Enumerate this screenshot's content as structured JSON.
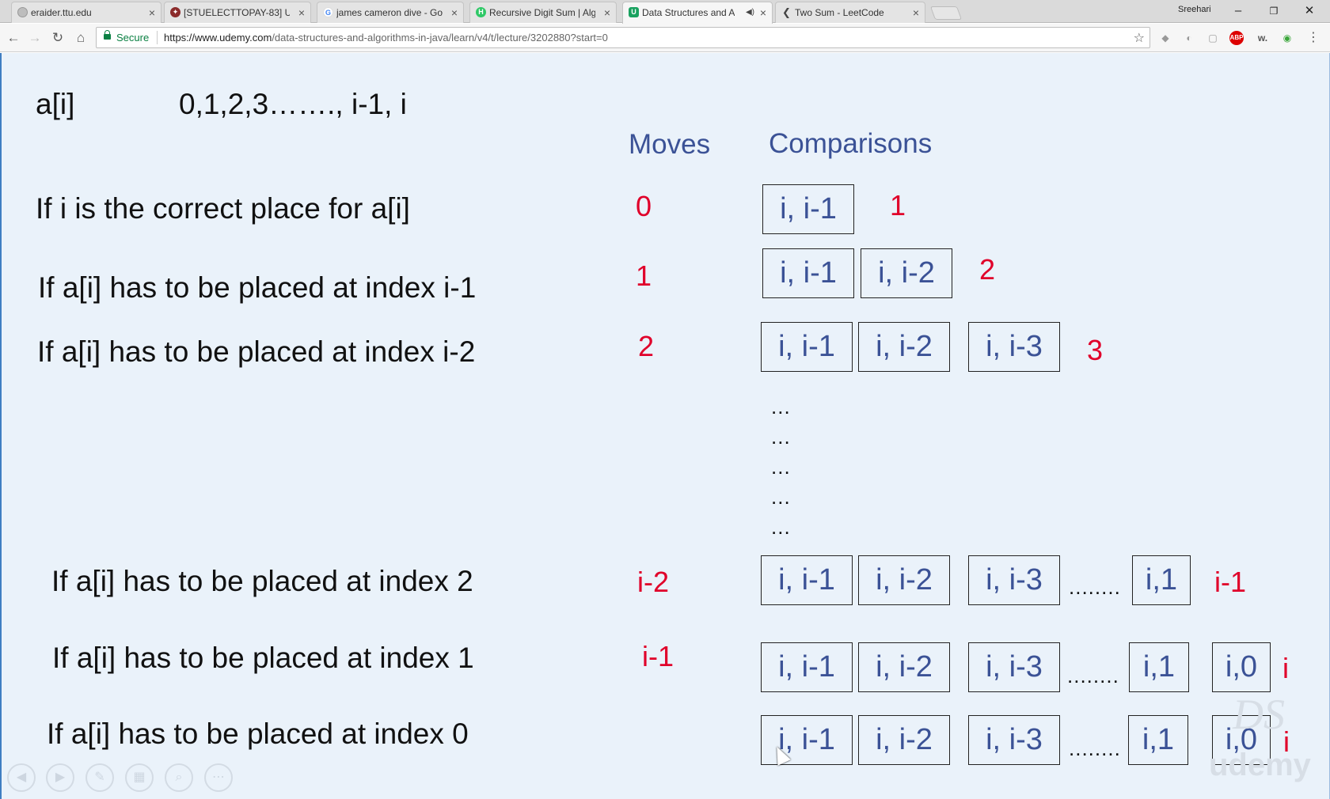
{
  "browser": {
    "tabs": [
      {
        "title": "eraider.ttu.edu",
        "icon": "ttu-favicon",
        "color": "#9a9a9a"
      },
      {
        "title": "[STUELECTTOPAY-83] Us",
        "icon": "jira-favicon",
        "color": "#8b2b2b"
      },
      {
        "title": "james cameron dive - Go",
        "icon": "google-favicon",
        "color": "#4285f4"
      },
      {
        "title": "Recursive Digit Sum | Alg",
        "icon": "hackerrank-favicon",
        "color": "#2ec866"
      },
      {
        "title": "Data Structures and A",
        "icon": "udemy-favicon",
        "color": "#1aa260",
        "active": true,
        "audio": true
      },
      {
        "title": "Two Sum - LeetCode",
        "icon": "leetcode-favicon",
        "color": "#444"
      }
    ],
    "profile_name": "Sreehari",
    "secure_label": "Secure",
    "url_host": "https://www.udemy.com",
    "url_path": "/data-structures-and-algorithms-in-java/learn/v4/t/lecture/3202880?start=0"
  },
  "slide": {
    "top_label": "a[i]",
    "top_seq": "0,1,2,3……., i-1, i",
    "moves_header": "Moves",
    "comparisons_header": "Comparisons",
    "rows": [
      {
        "text": "If i is the correct place for a[i]",
        "moves": "0",
        "boxes": [
          "i, i-1"
        ],
        "count": "1"
      },
      {
        "text": "If a[i] has to be placed at index i-1",
        "moves": "1",
        "boxes": [
          "i, i-1",
          "i, i-2"
        ],
        "count": "2"
      },
      {
        "text": "If a[i] has to be placed at index i-2",
        "moves": "2",
        "boxes": [
          "i, i-1",
          "i, i-2",
          "i, i-3"
        ],
        "count": "3"
      },
      {
        "text": "If a[i] has to be placed at index 2",
        "moves": "i-2",
        "boxes": [
          "i, i-1",
          "i, i-2",
          "i, i-3",
          "i,1"
        ],
        "count": "i-1"
      },
      {
        "text": "If a[i] has to be placed at index 1",
        "moves": "i-1",
        "boxes": [
          "i, i-1",
          "i, i-2",
          "i, i-3",
          "i,1",
          "i,0"
        ],
        "count": "i"
      },
      {
        "text": "If a[i] has to be placed at index 0",
        "moves": "",
        "boxes": [
          "i, i-1",
          "i, i-2",
          "i, i-3",
          "i,1",
          "i,0"
        ],
        "count": "i"
      }
    ],
    "vertical_dots": "...",
    "gap_dots": "........",
    "watermark_logo": "DS",
    "watermark_brand": "udemy"
  },
  "player_controls": [
    "prev-icon",
    "play-icon",
    "pen-icon",
    "gallery-icon",
    "zoom-icon",
    "more-icon"
  ]
}
